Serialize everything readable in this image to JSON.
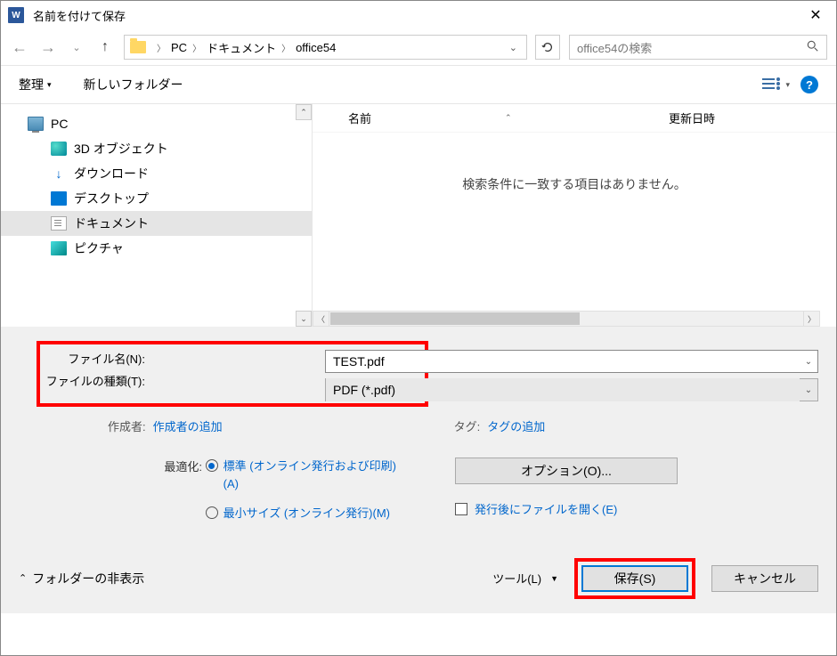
{
  "title": "名前を付けて保存",
  "breadcrumb": {
    "pc": "PC",
    "documents": "ドキュメント",
    "folder": "office54"
  },
  "search": {
    "placeholder": "office54の検索"
  },
  "toolbar": {
    "organize": "整理",
    "newfolder": "新しいフォルダー"
  },
  "tree": {
    "pc": "PC",
    "items": [
      "3D オブジェクト",
      "ダウンロード",
      "デスクトップ",
      "ドキュメント",
      "ピクチャ"
    ]
  },
  "filelist": {
    "headers": {
      "name": "名前",
      "modified": "更新日時"
    },
    "empty": "検索条件に一致する項目はありません。"
  },
  "fields": {
    "filename_label": "ファイル名(N):",
    "filename_value": "TEST.pdf",
    "filetype_label": "ファイルの種類(T):",
    "filetype_value": "PDF (*.pdf)"
  },
  "meta": {
    "author_label": "作成者:",
    "author_link": "作成者の追加",
    "tag_label": "タグ:",
    "tag_link": "タグの追加"
  },
  "optimize": {
    "label": "最適化:",
    "standard": "標準 (オンライン発行および印刷)(A)",
    "minimum": "最小サイズ (オンライン発行)(M)"
  },
  "options_btn": "オプション(O)...",
  "open_after": "発行後にファイルを開く(E)",
  "hide_folders": "フォルダーの非表示",
  "tools": "ツール(L)",
  "save_btn": "保存(S)",
  "cancel_btn": "キャンセル"
}
